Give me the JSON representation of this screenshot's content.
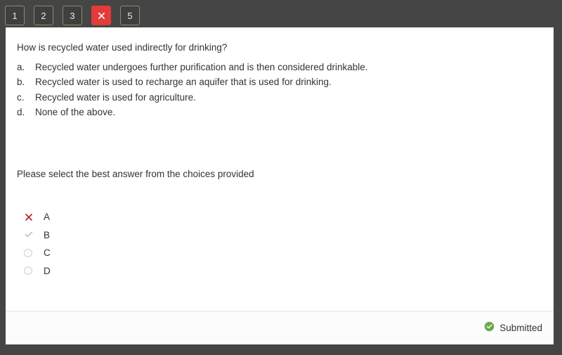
{
  "tabs": [
    {
      "label": "1",
      "state": "plain",
      "icon": ""
    },
    {
      "label": "2",
      "state": "plain",
      "icon": ""
    },
    {
      "label": "3",
      "state": "plain",
      "icon": ""
    },
    {
      "label": "",
      "state": "wrong",
      "icon": "x-mark-icon"
    },
    {
      "label": "5",
      "state": "plain",
      "icon": ""
    }
  ],
  "question": {
    "prompt": "How is recycled water used indirectly for drinking?",
    "choices": [
      {
        "letter": "a.",
        "text": "Recycled water undergoes further purification and is then considered drinkable."
      },
      {
        "letter": "b.",
        "text": "Recycled water is used to recharge an aquifer that is used for drinking."
      },
      {
        "letter": "c.",
        "text": "Recycled water is used for agriculture."
      },
      {
        "letter": "d.",
        "text": "None of the above."
      }
    ],
    "instruction": "Please select the best answer from the choices provided"
  },
  "answers": [
    {
      "label": "A",
      "mark": "x-mark-icon"
    },
    {
      "label": "B",
      "mark": "check-mark-icon"
    },
    {
      "label": "C",
      "mark": "radio-empty-icon"
    },
    {
      "label": "D",
      "mark": "radio-empty-icon"
    }
  ],
  "footer": {
    "status_icon": "check-circle-icon",
    "status_label": "Submitted"
  },
  "colors": {
    "page_background": "#454545",
    "card_background": "#ffffff",
    "tab_border": "#8a8f63",
    "tab_wrong_background": "#e33b3b",
    "incorrect_mark": "#b32a2a",
    "correct_mark": "#bdbdbd",
    "submitted_green": "#6aab4a",
    "text": "#333333"
  }
}
